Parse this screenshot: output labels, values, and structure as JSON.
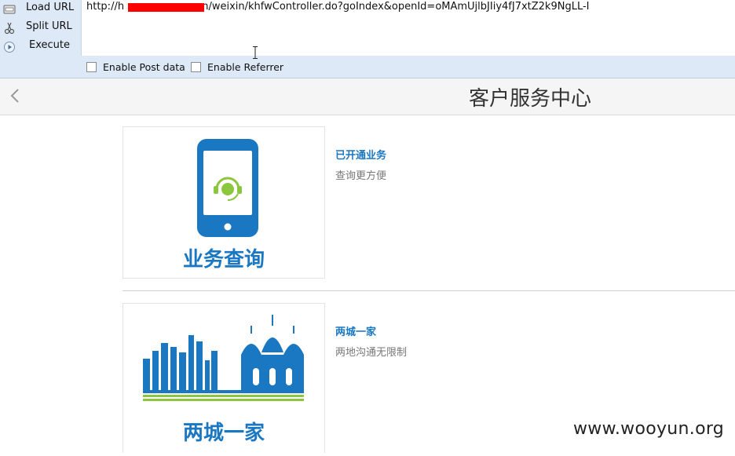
{
  "toolbar": {
    "load_url_label": "Load URL",
    "split_url_label": "Split URL",
    "execute_label": "Execute",
    "url_value": "http://h                        n/weixin/khfwController.do?goIndex&openId=oMAmUjlbJIiy4fJ7xtZ2k9NgLL-I",
    "enable_post_label": "Enable Post data",
    "enable_referrer_label": "Enable Referrer"
  },
  "header": {
    "title": "客户服务中心"
  },
  "items": [
    {
      "image_caption": "业务查询",
      "title": "已开通业务",
      "desc": "查询更方便"
    },
    {
      "image_caption": "两城一家",
      "title": "两城一家",
      "desc": "两地沟通无限制"
    }
  ],
  "watermark": "www.wooyun.org",
  "colors": {
    "toolbar_bg": "#dde9f6",
    "brand_blue": "#1a78c2",
    "accent_green": "#8cc63f",
    "redaction": "#ff0000"
  }
}
